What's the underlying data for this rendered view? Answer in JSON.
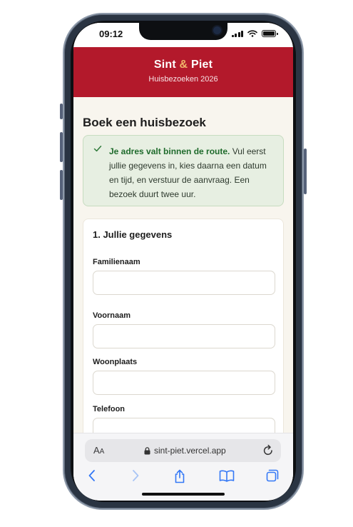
{
  "status_bar": {
    "time": "09:12"
  },
  "site": {
    "brand_part1": "Sint ",
    "brand_amp": "&",
    "brand_part2": " Piet",
    "tagline": "Huisbezoeken 2026",
    "colors": {
      "header": "#b3192b",
      "amp": "#f0b46a",
      "success": "#1f6b2c"
    }
  },
  "page": {
    "title": "Boek een huisbezoek",
    "alert": {
      "icon": "check-icon",
      "bold": "Je adres valt binnen de route.",
      "text": " Vul eerst jullie gegevens in, kies daarna een datum en tijd, en verstuur de aanvraag. Een bezoek duurt twee uur."
    },
    "form": {
      "heading": "1. Jullie gegevens",
      "fields": [
        {
          "label": "Familienaam",
          "value": ""
        },
        {
          "label": "Voornaam",
          "value": ""
        },
        {
          "label": "Woonplaats",
          "value": ""
        },
        {
          "label": "Telefoon",
          "value": ""
        }
      ]
    }
  },
  "browser": {
    "aa_big": "A",
    "aa_small": "A",
    "url": "sint-piet.vercel.app",
    "toolbar_icons": [
      "back-icon",
      "forward-icon",
      "share-icon",
      "bookmarks-icon",
      "tabs-icon"
    ]
  }
}
